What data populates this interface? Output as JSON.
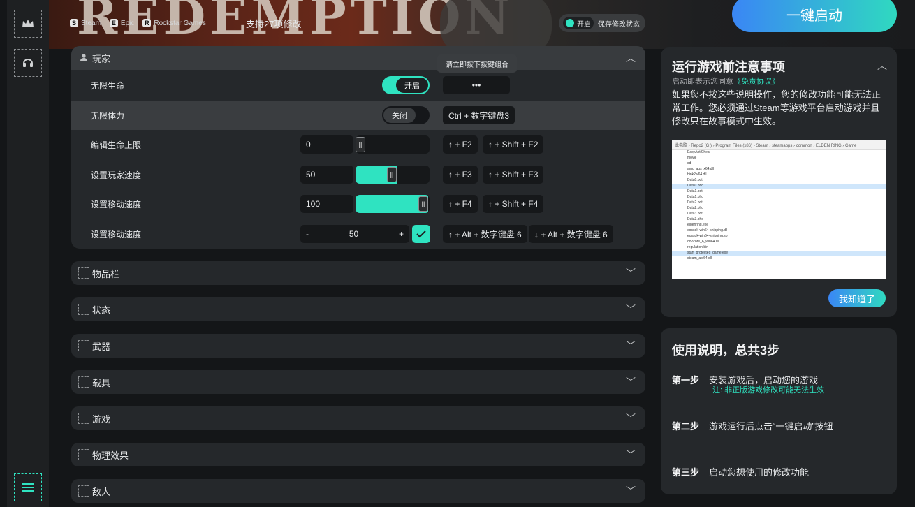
{
  "banner": {
    "title": "REDEMPTION"
  },
  "platforms": [
    {
      "name": "Steam",
      "icon": "steam-icon"
    },
    {
      "name": "Epic",
      "icon": "epic-icon"
    },
    {
      "name": "Rockstar Games",
      "icon": "rockstar-icon"
    }
  ],
  "support_text": "支持27项修改",
  "save_toggle": {
    "state": "开启",
    "label": "保存修改状态"
  },
  "launch_button": "一键启动",
  "player_section": {
    "title": "玩家",
    "tooltip": "请立即按下按键组合",
    "rows": [
      {
        "label": "无限生命",
        "toggle": "开启",
        "key1": "•••"
      },
      {
        "label": "无限体力",
        "toggle": "关闭",
        "key1": "Ctrl + 数字键盘3"
      },
      {
        "label": "编辑生命上限",
        "value": "0",
        "key1": "↑ + F2",
        "key2": "↑ + Shift + F2",
        "fill": 0.0
      },
      {
        "label": "设置玩家速度",
        "value": "50",
        "key1": "↑ + F3",
        "key2": "↑ + Shift + F3",
        "fill": 0.5
      },
      {
        "label": "设置移动速度",
        "value": "100",
        "key1": "↑ + F4",
        "key2": "↑ + Shift + F4",
        "fill": 1.0
      },
      {
        "label": "设置移动速度",
        "value": "50",
        "minus": "-",
        "plus": "+",
        "key1": "↑ + Alt + 数字键盘 6",
        "key2": "↓ + Alt + 数字键盘 6"
      }
    ]
  },
  "categories": [
    "物品栏",
    "状态",
    "武器",
    "载具",
    "游戏",
    "物理效果",
    "敌人"
  ],
  "notice": {
    "title": "运行游戏前注意事项",
    "sub_prefix": "启动即表示您同意",
    "sub_link": "《免责协议》",
    "body": "如果您不按这些说明操作，您的修改功能可能无法正常工作。您必须通过Steam等游戏平台启动游戏并且修改只在故事模式中生效。",
    "screenshot_path": "此电脑 › Repo2 (G:) › Program Files (x86) › Steam › steamapps › common › ELDEN RING › Game",
    "files": [
      "EasyAntiCheat",
      "movie",
      "sd",
      "amd_ags_x64.dll",
      "bink2w64.dll",
      "Data0.bdt",
      "Data0.bhd",
      "Data1.bdt",
      "Data1.bhd",
      "Data2.bdt",
      "Data2.bhd",
      "Data3.bdt",
      "Data3.bhd",
      "eldenring.exe",
      "eossdk-win64-shipping.dll",
      "eossdk-win64-shipping.so",
      "oo2core_6_win64.dll",
      "regulation.bin",
      "start_protected_game.exe",
      "steam_api64.dll"
    ],
    "button": "我知道了"
  },
  "instructions": {
    "title": "使用说明，总共3步",
    "steps": [
      {
        "label": "第一步",
        "text": "安装游戏后，启动您的游戏",
        "note": "注: 非正版游戏修改可能无法生效"
      },
      {
        "label": "第二步",
        "text": "游戏运行后点击“一键启动”按钮"
      },
      {
        "label": "第三步",
        "text": "启动您想使用的修改功能"
      }
    ]
  },
  "colors": {
    "accent": "#2fe3c1",
    "blue": "#3a86f5",
    "panel": "#25282b"
  }
}
